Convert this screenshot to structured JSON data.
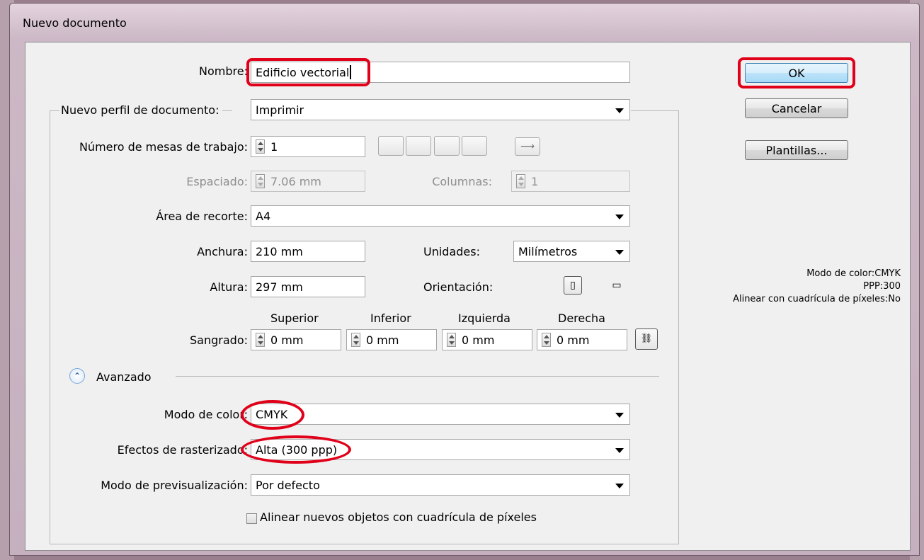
{
  "window": {
    "title": "Nuevo documento"
  },
  "form": {
    "name_label": "Nombre:",
    "name_value": "Edificio vectorial",
    "profile_label": "Nuevo perfil de documento:",
    "profile_value": "Imprimir",
    "artboards_label": "Número de mesas de trabajo:",
    "artboards_value": "1",
    "spacing_label": "Espaciado:",
    "spacing_value": "7.06 mm",
    "columns_label": "Columnas:",
    "columns_value": "1",
    "cropbox_label": "Área de recorte:",
    "cropbox_value": "A4",
    "width_label": "Anchura:",
    "width_value": "210 mm",
    "units_label": "Unidades:",
    "units_value": "Milímetros",
    "height_label": "Altura:",
    "height_value": "297 mm",
    "orientation_label": "Orientación:",
    "bleed_label": "Sangrado:",
    "bleed_top_label": "Superior",
    "bleed_top_value": "0 mm",
    "bleed_bottom_label": "Inferior",
    "bleed_bottom_value": "0 mm",
    "bleed_left_label": "Izquierda",
    "bleed_left_value": "0 mm",
    "bleed_right_label": "Derecha",
    "bleed_right_value": "0 mm",
    "advanced_label": "Avanzado",
    "colormode_label": "Modo de color:",
    "colormode_value": "CMYK",
    "raster_label": "Efectos de rasterizado:",
    "raster_value": "Alta (300 ppp)",
    "preview_label": "Modo de previsualización:",
    "preview_value": "Por defecto",
    "align_checkbox_label": "Alinear nuevos objetos con cuadrícula de píxeles",
    "align_checkbox_checked": false
  },
  "buttons": {
    "ok": "OK",
    "cancel": "Cancelar",
    "templates": "Plantillas..."
  },
  "summary": {
    "color_mode": "Modo de color:CMYK",
    "ppp": "PPP:300",
    "align": "Alinear con cuadrícula de píxeles:No"
  },
  "colors": {
    "highlight": "#e0001a",
    "default_button": "#a7d9f5"
  }
}
